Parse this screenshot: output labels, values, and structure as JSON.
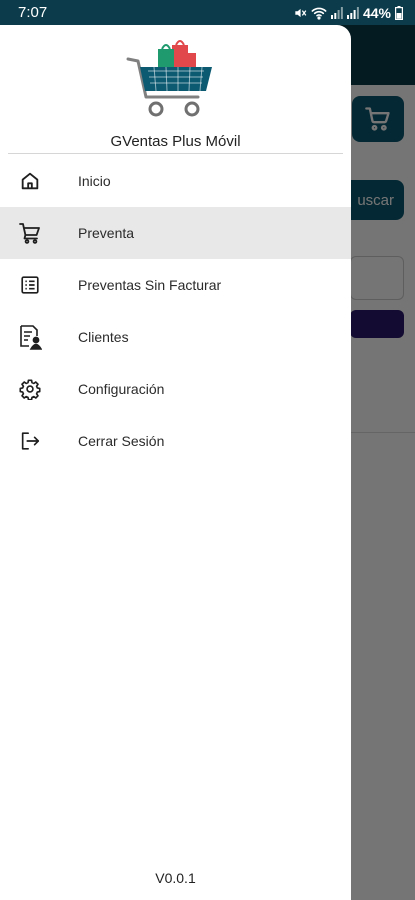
{
  "status_bar": {
    "time": "7:07",
    "battery": "44%"
  },
  "drawer": {
    "app_name": "GVentas Plus Móvil",
    "menu": [
      {
        "label": "Inicio",
        "icon": "home-icon"
      },
      {
        "label": "Preventa",
        "icon": "cart-icon",
        "selected": true
      },
      {
        "label": "Preventas Sin Facturar",
        "icon": "list-icon"
      },
      {
        "label": "Clientes",
        "icon": "client-icon"
      },
      {
        "label": "Configuración",
        "icon": "gear-icon"
      },
      {
        "label": "Cerrar Sesión",
        "icon": "logout-icon"
      }
    ],
    "version": "V0.0.1"
  },
  "background": {
    "search_label": "uscar"
  },
  "colors": {
    "primary": "#0c3c4b",
    "accent": "#0c5a72",
    "selected_bg": "#e8e8e8"
  }
}
